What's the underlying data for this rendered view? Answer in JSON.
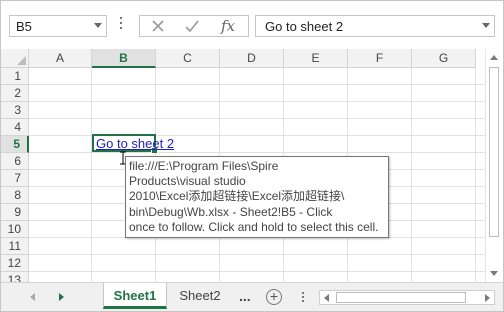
{
  "formula_bar": {
    "name_box": "B5",
    "formula": "Go to sheet 2",
    "cancel_icon": "x-icon",
    "enter_icon": "check-icon",
    "function_label": "fx"
  },
  "columns": [
    "A",
    "B",
    "C",
    "D",
    "E",
    "F",
    "G"
  ],
  "rows": [
    "1",
    "2",
    "3",
    "4",
    "5",
    "6",
    "7",
    "8",
    "9",
    "10",
    "11",
    "12",
    "13"
  ],
  "selection": {
    "column": "B",
    "row": "5"
  },
  "cell_b5": {
    "text": "Go to sheet 2"
  },
  "tooltip": {
    "lines": [
      "file:///E:\\Program Files\\Spire",
      "Products\\visual studio",
      "2010\\Excel添加超链接\\Excel添加超链接\\",
      "bin\\Debug\\Wb.xlsx - Sheet2!B5 - Click",
      "once to follow. Click and hold to select this cell."
    ]
  },
  "sheet_tabs": {
    "tabs": [
      "Sheet1",
      "Sheet2"
    ],
    "active": "Sheet1",
    "more_label": "...",
    "add_label": "+"
  },
  "colors": {
    "accent": "#217346",
    "link": "#1f1fbf"
  }
}
